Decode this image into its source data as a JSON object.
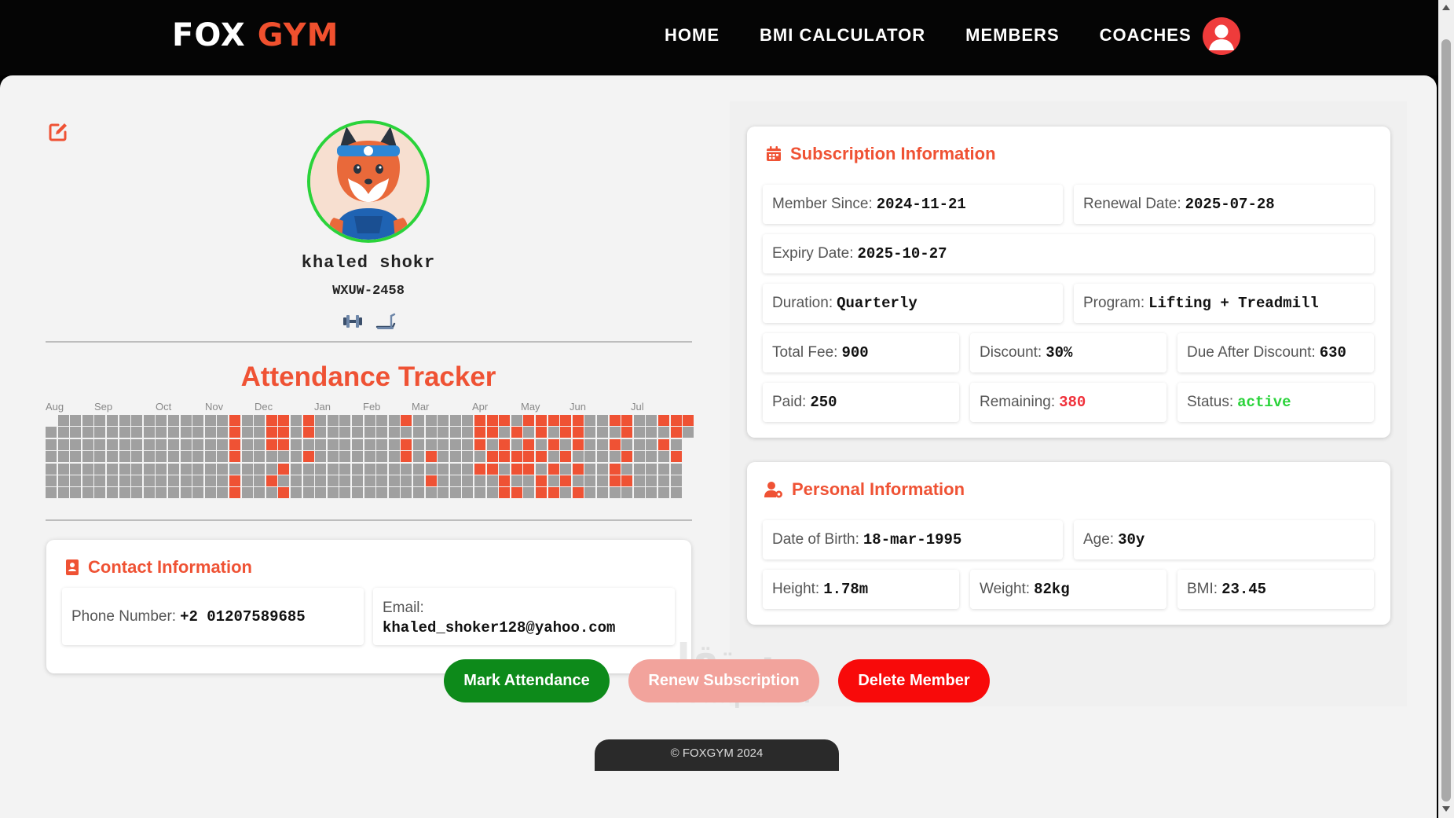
{
  "brand": {
    "word1": "FOX",
    "word2": "GYM"
  },
  "nav": {
    "home": "HOME",
    "bmi": "BMI CALCULATOR",
    "members": "MEMBERS",
    "coaches": "COACHES"
  },
  "profile": {
    "name": "khaled shokr",
    "id": "WXUW-2458",
    "program_icons": [
      "dumbbell-icon",
      "treadmill-icon"
    ]
  },
  "attendance": {
    "title": "Attendance Tracker",
    "months": [
      "Aug",
      "Sep",
      "Oct",
      "Nov",
      "Dec",
      "Jan",
      "Feb",
      "Mar",
      "Apr",
      "May",
      "Jun",
      "Jul"
    ],
    "attended_color": "#ef5234",
    "absent_color": "#a0a0a0"
  },
  "contact": {
    "title": "Contact Information",
    "phone_label": "Phone Number:",
    "phone": "+2 01207589685",
    "email_label": "Email:",
    "email": "khaled_shoker128@yahoo.com"
  },
  "subscription": {
    "title": "Subscription Information",
    "member_since_label": "Member Since:",
    "member_since": "2024-11-21",
    "renewal_label": "Renewal Date:",
    "renewal": "2025-07-28",
    "expiry_label": "Expiry Date:",
    "expiry": "2025-10-27",
    "duration_label": "Duration:",
    "duration": "Quarterly",
    "program_label": "Program:",
    "program": "Lifting + Treadmill",
    "total_fee_label": "Total Fee:",
    "total_fee": "900",
    "discount_label": "Discount:",
    "discount": "30%",
    "due_label": "Due After Discount:",
    "due": "630",
    "paid_label": "Paid:",
    "paid": "250",
    "remaining_label": "Remaining:",
    "remaining": "380",
    "status_label": "Status:",
    "status": "active"
  },
  "personal": {
    "title": "Personal Information",
    "dob_label": "Date of Birth:",
    "dob": "18-mar-1995",
    "age_label": "Age:",
    "age": "30y",
    "height_label": "Height:",
    "height": "1.78m",
    "weight_label": "Weight:",
    "weight": "82kg",
    "bmi_label": "BMI:",
    "bmi": "23.45"
  },
  "actions": {
    "mark_attendance": "Mark Attendance",
    "renew": "Renew Subscription",
    "delete": "Delete Member"
  },
  "footer": "© FOXGYM 2024",
  "watermark": {
    "arabic": "مستقل",
    "latin": "mostaql.com"
  },
  "colors": {
    "accent": "#ef5234",
    "navbar": "#050505",
    "green": "#0d8a1a",
    "danger": "#f80a0a",
    "status_active": "#2ad33a"
  }
}
